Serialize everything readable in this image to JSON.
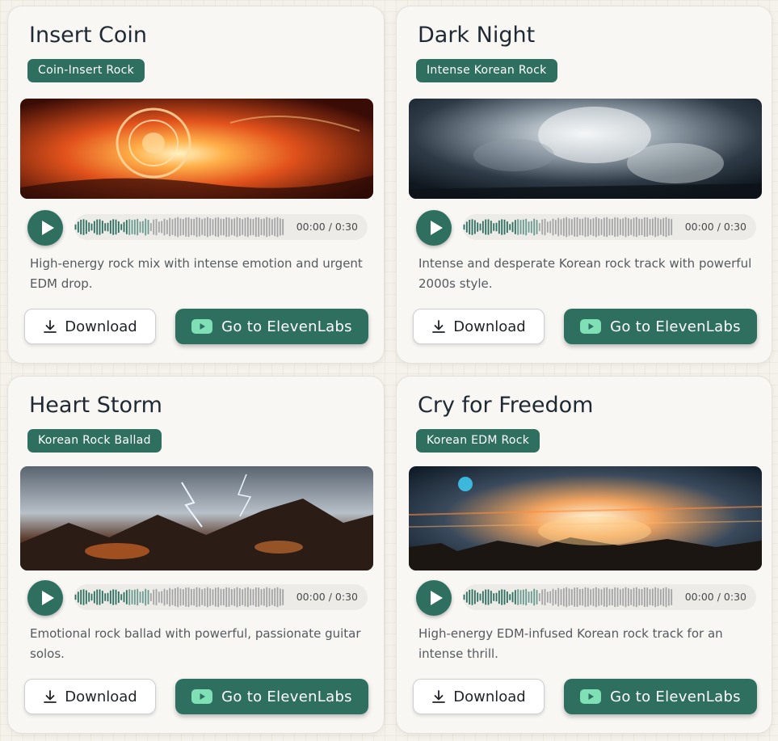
{
  "colors": {
    "accent": "#2e6f60",
    "background": "#f4f2ea",
    "card": "#f8f7f4"
  },
  "cards": [
    {
      "title": "Insert Coin",
      "genre": "Coin-Insert Rock",
      "image_icon": "fiery-coin-explosion-artwork",
      "time": "00:00 / 0:30",
      "description": "High-energy rock mix with intense emotion and urgent EDM drop.",
      "download_label": "Download",
      "elevenlabs_label": "Go to ElevenLabs"
    },
    {
      "title": "Dark Night",
      "genre": "Intense Korean Rock",
      "image_icon": "stormy-night-clouds-artwork",
      "time": "00:00 / 0:30",
      "description": "Intense and desperate Korean rock track with powerful 2000s style.",
      "download_label": "Download",
      "elevenlabs_label": "Go to ElevenLabs"
    },
    {
      "title": "Heart Storm",
      "genre": "Korean Rock Ballad",
      "image_icon": "lightning-mountain-storm-artwork",
      "time": "00:00 / 0:30",
      "description": "Emotional rock ballad with powerful, passionate guitar solos.",
      "download_label": "Download",
      "elevenlabs_label": "Go to ElevenLabs"
    },
    {
      "title": "Cry for Freedom",
      "genre": "Korean EDM Rock",
      "image_icon": "neon-city-explosion-artwork",
      "time": "00:00 / 0:30",
      "description": "High-energy EDM-infused Korean rock track for an intense thrill.",
      "download_label": "Download",
      "elevenlabs_label": "Go to ElevenLabs"
    }
  ]
}
